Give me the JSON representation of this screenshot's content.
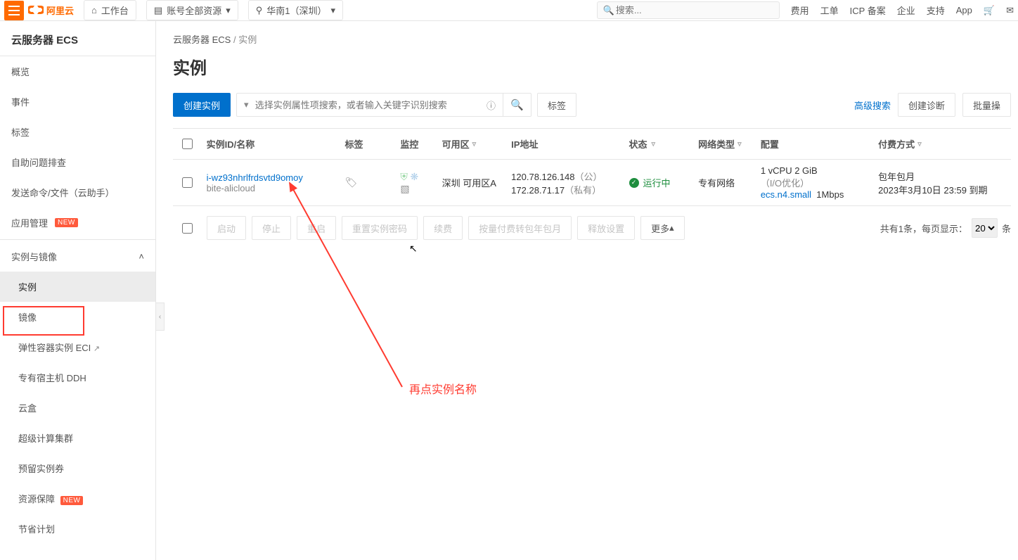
{
  "top": {
    "logo_text": "阿里云",
    "workspace": "工作台",
    "resources": "账号全部资源",
    "region": "华南1（深圳）",
    "search_placeholder": "搜索...",
    "links": [
      "费用",
      "工单",
      "ICP 备案",
      "企业",
      "支持",
      "App"
    ]
  },
  "sidebar": {
    "title": "云服务器 ECS",
    "top_items": [
      "概览",
      "事件",
      "标签",
      "自助问题排查",
      "发送命令/文件（云助手）"
    ],
    "app_mgmt": "应用管理",
    "group1": {
      "label": "实例与镜像",
      "open": true,
      "items": [
        "实例",
        "镜像",
        "弹性容器实例 ECI",
        "专有宿主机 DDH",
        "云盒",
        "超级计算集群",
        "预留实例券",
        "资源保障",
        "节省计划"
      ]
    },
    "active_index": 0
  },
  "crumbs": {
    "root": "云服务器 ECS",
    "sep": "/",
    "cur": "实例"
  },
  "page_title": "实例",
  "toolbar": {
    "create": "创建实例",
    "search_placeholder": "选择实例属性项搜索，或者输入关键字识别搜索",
    "tag_btn": "标签",
    "adv_search": "高级搜索",
    "diagnose": "创建诊断",
    "batch": "批量操"
  },
  "columns": {
    "id": "实例ID/名称",
    "tag": "标签",
    "mon": "监控",
    "zone": "可用区",
    "ip": "IP地址",
    "status": "状态",
    "net": "网络类型",
    "spec": "配置",
    "pay": "付费方式"
  },
  "row": {
    "id": "i-wz93nhrlfrdsvtd9omoy",
    "name": "bite-alicloud",
    "zone": "深圳 可用区A",
    "ip_pub": "120.78.126.148",
    "ip_pub_lbl": "（公）",
    "ip_pri": "172.28.71.17",
    "ip_pri_lbl": "（私有）",
    "status": "运行中",
    "net": "专有网络",
    "spec1": "1 vCPU 2 GiB",
    "spec1b": "（I/O优化）",
    "spec2": "ecs.n4.small",
    "spec2b": "1Mbps",
    "pay1": "包年包月",
    "pay2": "2023年3月10日 23:59 到期"
  },
  "bulk": {
    "start": "启动",
    "stop": "停止",
    "restart": "重启",
    "reset_pwd": "重置实例密码",
    "renew": "续费",
    "switch": "按量付费转包年包月",
    "release": "释放设置",
    "more": "更多",
    "page_text_a": "共有1条，每页显示：",
    "page_size": "20",
    "page_text_b": "条"
  },
  "annotation": {
    "text": "再点实例名称"
  }
}
